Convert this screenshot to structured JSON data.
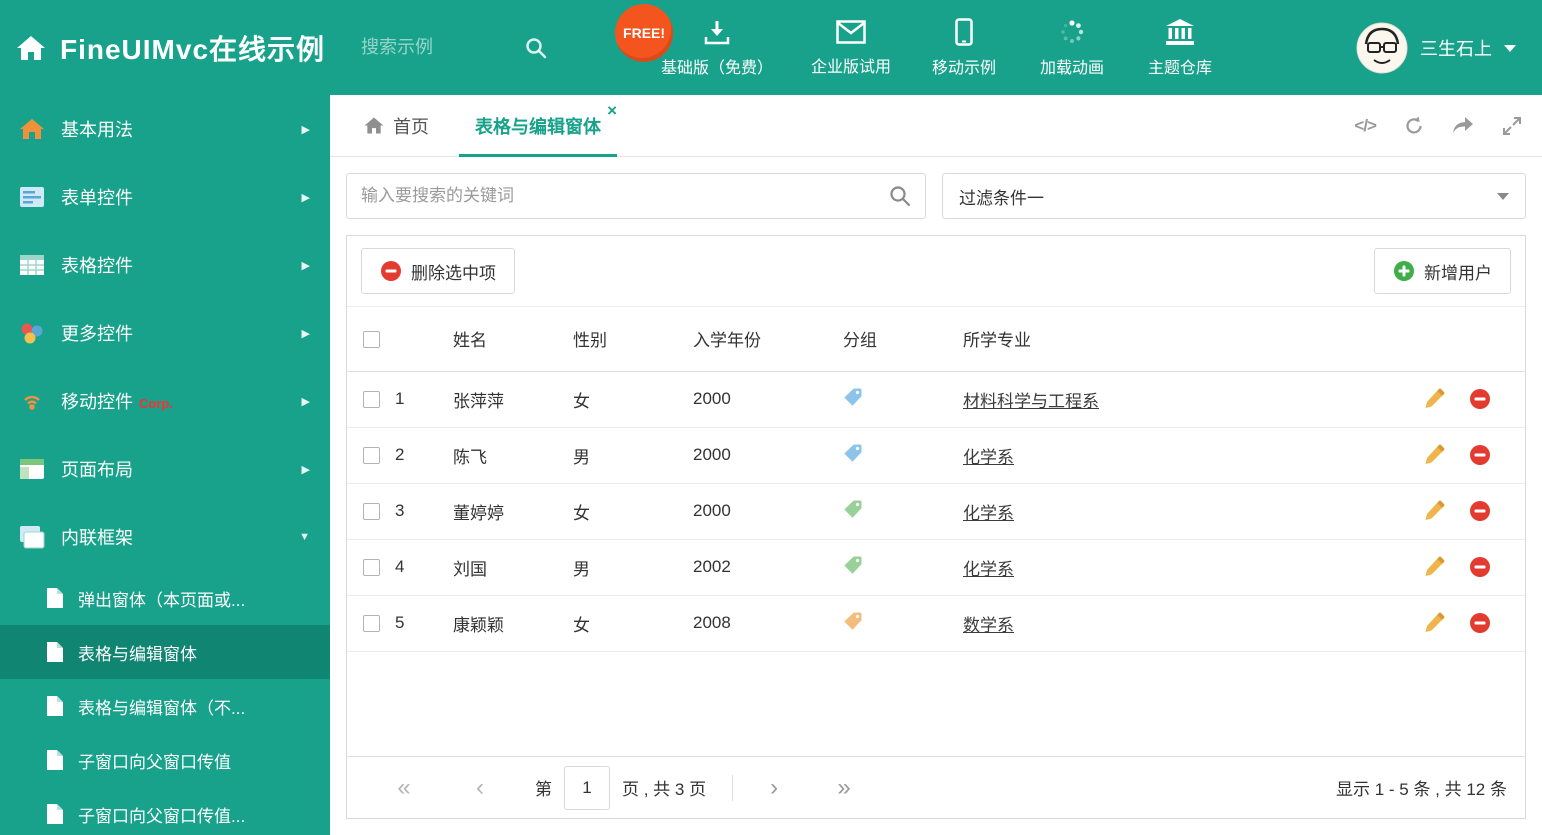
{
  "colors": {
    "accent": "#18a28b",
    "sidebar_active": "#0f8572",
    "free_badge": "#f4541d",
    "delete_red": "#e23b30",
    "add_green": "#3fae49"
  },
  "icons": {
    "close": "×",
    "code": "</>",
    "first": "«",
    "prev": "‹",
    "next": "›",
    "last": "»",
    "arrow_right": "▶",
    "arrow_down": "▼"
  },
  "header": {
    "title": "FineUIMvc在线示例",
    "search_placeholder": "搜索示例",
    "free_badge": "FREE!",
    "nav": [
      {
        "label": "基础版（免费）",
        "icon": "download-icon"
      },
      {
        "label": "企业版试用",
        "icon": "envelope-icon"
      },
      {
        "label": "移动示例",
        "icon": "mobile-icon"
      },
      {
        "label": "加载动画",
        "icon": "spinner-icon"
      },
      {
        "label": "主题仓库",
        "icon": "bank-icon"
      }
    ],
    "username": "三生石上"
  },
  "sidebar": {
    "items": [
      {
        "label": "基本用法",
        "icon": "home-icon"
      },
      {
        "label": "表单控件",
        "icon": "form-icon"
      },
      {
        "label": "表格控件",
        "icon": "table-icon"
      },
      {
        "label": "更多控件",
        "icon": "more-icon"
      },
      {
        "label": "移动控件",
        "badge": "Corp.",
        "icon": "beacon-icon"
      },
      {
        "label": "页面布局",
        "icon": "layout-icon"
      },
      {
        "label": "内联框架",
        "icon": "frame-icon",
        "expanded": true
      }
    ],
    "subitems": [
      {
        "label": "弹出窗体（本页面或..."
      },
      {
        "label": "表格与编辑窗体",
        "active": true
      },
      {
        "label": "表格与编辑窗体（不..."
      },
      {
        "label": "子窗口向父窗口传值"
      },
      {
        "label": "子窗口向父窗口传值..."
      }
    ]
  },
  "tabs": {
    "home": "首页",
    "active": "表格与编辑窗体"
  },
  "filter": {
    "search_placeholder": "输入要搜索的关键词",
    "dropdown_value": "过滤条件一"
  },
  "toolbar": {
    "delete_selected": "删除选中项",
    "add_user": "新增用户"
  },
  "table": {
    "columns": [
      "姓名",
      "性别",
      "入学年份",
      "分组",
      "所学专业"
    ],
    "rows": [
      {
        "index": "1",
        "name": "张萍萍",
        "gender": "女",
        "year": "2000",
        "tag_color": "#8fc4ea",
        "major": "材料科学与工程系"
      },
      {
        "index": "2",
        "name": "陈飞",
        "gender": "男",
        "year": "2000",
        "tag_color": "#8fc4ea",
        "major": "化学系"
      },
      {
        "index": "3",
        "name": "董婷婷",
        "gender": "女",
        "year": "2000",
        "tag_color": "#98d098",
        "major": "化学系"
      },
      {
        "index": "4",
        "name": "刘国",
        "gender": "男",
        "year": "2002",
        "tag_color": "#98d098",
        "major": "化学系"
      },
      {
        "index": "5",
        "name": "康颖颖",
        "gender": "女",
        "year": "2008",
        "tag_color": "#f3bd7f",
        "major": "数学系"
      }
    ]
  },
  "pagination": {
    "page_prefix": "第",
    "current_page": "1",
    "page_suffix": "页 , 共 3 页",
    "summary": "显示 1 - 5 条 , 共 12 条"
  }
}
